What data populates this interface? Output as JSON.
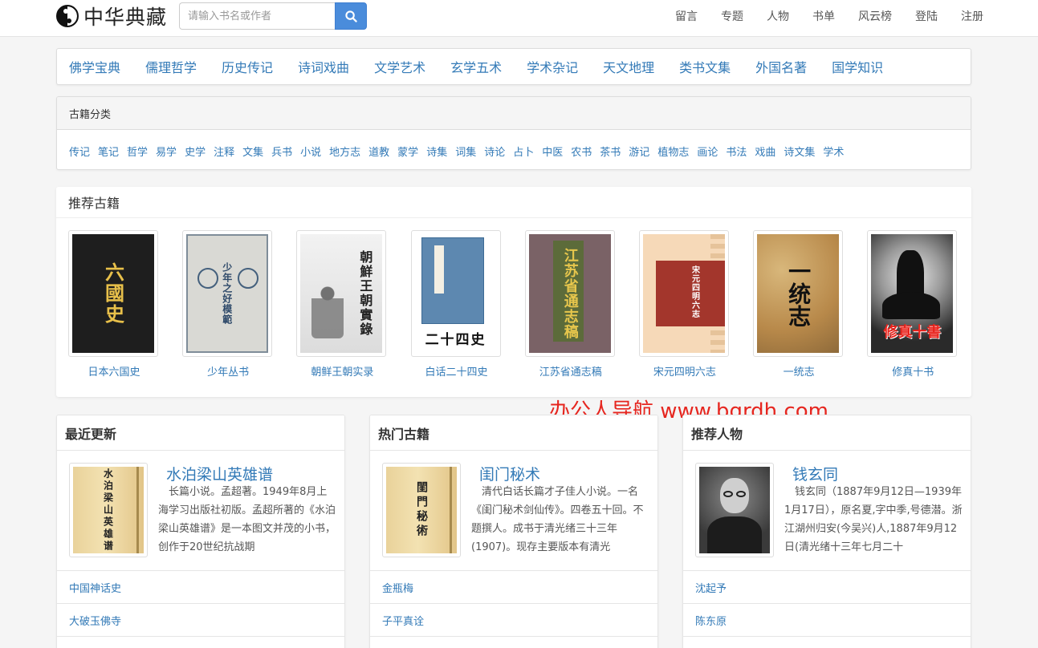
{
  "brand": {
    "name": "中华典藏"
  },
  "search": {
    "placeholder": "请输入书名或作者"
  },
  "topnav": [
    "留言",
    "专题",
    "人物",
    "书单",
    "风云榜",
    "登陆",
    "注册"
  ],
  "categories": [
    "佛学宝典",
    "儒理哲学",
    "历史传记",
    "诗词戏曲",
    "文学艺术",
    "玄学五术",
    "学术杂记",
    "天文地理",
    "类书文集",
    "外国名著",
    "国学知识"
  ],
  "ancient": {
    "title": "古籍分类",
    "tags": [
      "传记",
      "笔记",
      "哲学",
      "易学",
      "史学",
      "注释",
      "文集",
      "兵书",
      "小说",
      "地方志",
      "道教",
      "蒙学",
      "诗集",
      "词集",
      "诗论",
      "占卜",
      "中医",
      "农书",
      "茶书",
      "游记",
      "植物志",
      "画论",
      "书法",
      "戏曲",
      "诗文集",
      "学术"
    ]
  },
  "recommend": {
    "title": "推荐古籍",
    "books": [
      {
        "title": "日本六国史",
        "cover_text": "六國史"
      },
      {
        "title": "少年丛书",
        "cover_text": "少年之好模範"
      },
      {
        "title": "朝鲜王朝实录",
        "cover_text": "朝鮮王朝實錄"
      },
      {
        "title": "白话二十四史",
        "cover_text": "二十四史"
      },
      {
        "title": "江苏省通志稿",
        "cover_text": "江苏省通志稿"
      },
      {
        "title": "宋元四明六志",
        "cover_text": "宋元四明六志"
      },
      {
        "title": "一统志",
        "cover_text": "一统志"
      },
      {
        "title": "修真十书",
        "cover_text": "修真十書"
      }
    ]
  },
  "watermark": "办公人导航 www.bgrdh.com",
  "columns": [
    {
      "title": "最近更新",
      "feature": {
        "title": "水泊梁山英雄谱",
        "thumb_text": "水泊梁山英雄谱",
        "desc": "长篇小说。孟超著。1949年8月上海学习出版社初版。孟超所著的《水泊梁山英雄谱》是一本图文并茂的小书，创作于20世纪抗战期"
      },
      "items": [
        "中国神话史",
        "大破玉佛寺"
      ]
    },
    {
      "title": "热门古籍",
      "feature": {
        "title": "闺门秘术",
        "thumb_text": "閨門秘術",
        "desc": "清代白话长篇才子佳人小说。一名《闺门秘术剑仙传》。四卷五十回。不题撰人。成书于清光绪三十三年(1907)。现存主要版本有清光"
      },
      "items": [
        "金瓶梅",
        "子平真诠"
      ]
    },
    {
      "title": "推荐人物",
      "feature": {
        "title": "钱玄同",
        "desc": "钱玄同（1887年9月12日—1939年1月17日），原名夏,字中季,号德潜。浙江湖州归安(今吴兴)人,1887年9月12日(清光绪十三年七月二十"
      },
      "items": [
        "沈起予",
        "陈东原"
      ]
    }
  ]
}
